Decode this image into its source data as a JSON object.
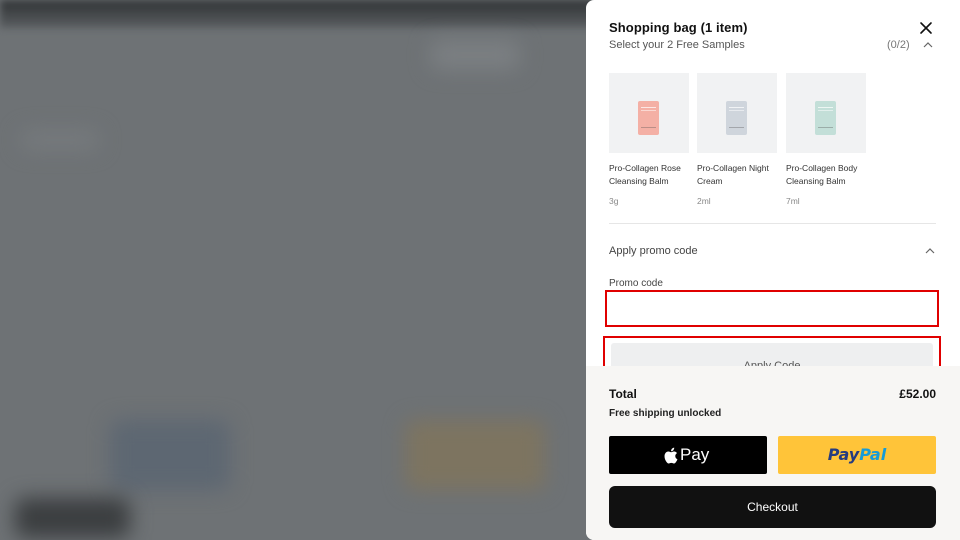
{
  "cart": {
    "title": "Shopping bag (1 item)",
    "samples_label": "Select your 2 Free Samples",
    "samples_count": "(0/2)",
    "samples": [
      {
        "name": "Pro-Collagen Rose Cleansing Balm",
        "size": "3g",
        "color": "#f4b0a5"
      },
      {
        "name": "Pro-Collagen Night Cream",
        "size": "2ml",
        "color": "#cfd5dc"
      },
      {
        "name": "Pro-Collagen Body Cleansing Balm",
        "size": "7ml",
        "color": "#c3dfd8"
      }
    ],
    "promo_toggle": "Apply promo code",
    "promo_field_label": "Promo code",
    "promo_value": "",
    "apply_label": "Apply Code",
    "total_label": "Total",
    "total_value": "£52.00",
    "shipping_text": "Free shipping unlocked",
    "applepay_label": "Pay",
    "paypal_part1": "Pay",
    "paypal_part2": "Pal",
    "checkout_label": "Checkout"
  },
  "colors": {
    "paypal_yellow": "#ffc439",
    "highlight_red": "#e00000",
    "checkout_black": "#111111"
  }
}
